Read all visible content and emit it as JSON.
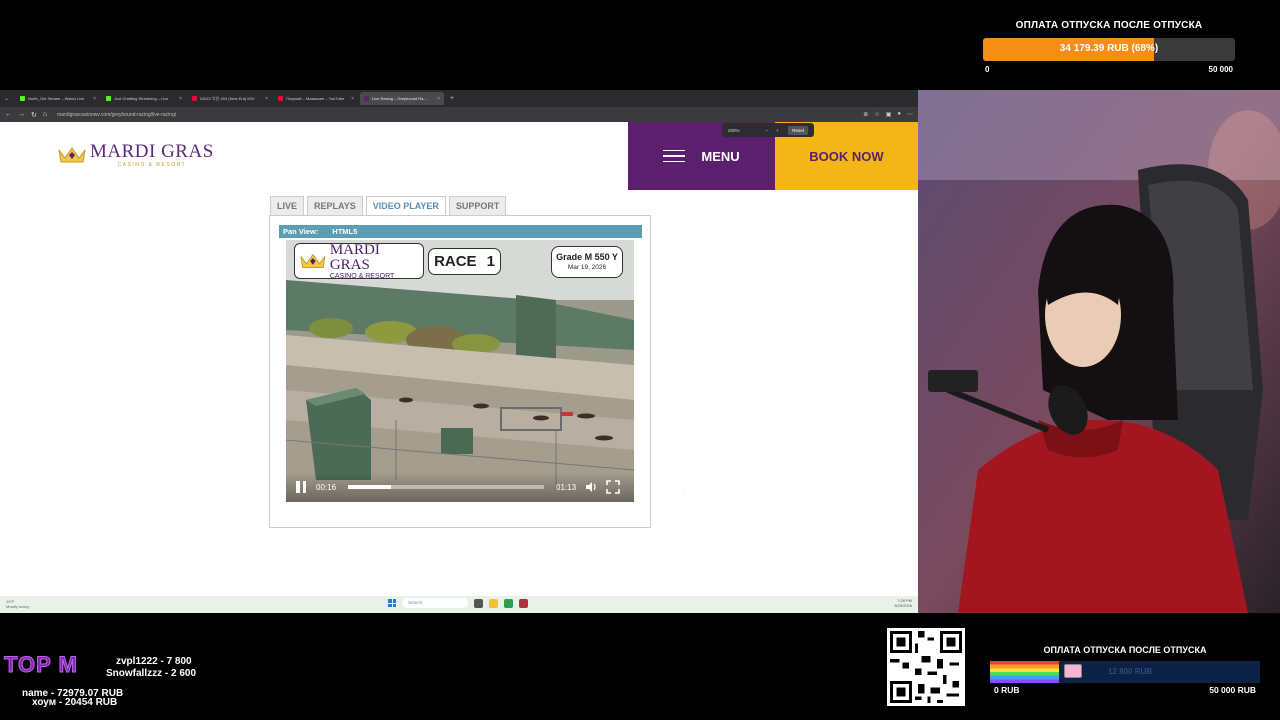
{
  "stream_goal_top": {
    "title": "ОПЛАТА ОТПУСКА ПОСЛЕ ОТПУСКА",
    "progress_text": "34 179.39 RUB (68%)",
    "progress_fraction": 0.68,
    "min_label": "0",
    "max_label": "50 000",
    "fill_color": "#f58d16"
  },
  "browser": {
    "tabs": [
      {
        "label": "North_Girl Stream – Watch Live",
        "fav_color": "#53fc18"
      },
      {
        "label": "Just Chatting Streaming – Live",
        "fav_color": "#53fc18"
      },
      {
        "label": "IGIDS 악인 404 (New Era) M/V",
        "fav_color": "#ff0033"
      },
      {
        "label": "Покупай – Мамашин – YouTube",
        "fav_color": "#ff0033"
      },
      {
        "label": "Live Racing – Greyhound Ra…",
        "fav_color": "#5b1f6e"
      }
    ],
    "active_tab_index": 4,
    "url": "mardigrascasinowv.com/greyhound-racing/live-racing/",
    "zoom": {
      "value": "200%",
      "minus": "–",
      "plus": "+",
      "reset_label": "Reset"
    }
  },
  "site": {
    "logo_text": "MARDI GRAS",
    "logo_sub": "CASINO & RESORT",
    "menu_label": "MENU",
    "book_label": "BOOK NOW",
    "brand_purple": "#5b1f6e",
    "brand_gold": "#f4b617",
    "page_tabs": [
      "LIVE",
      "REPLAYS",
      "VIDEO PLAYER",
      "SUPPORT"
    ],
    "active_page_tab": 2,
    "pan_view_label": "Pan View:",
    "pan_view_value": "HTML5"
  },
  "video": {
    "overlay_logo_1": "MARDI GRAS",
    "overlay_logo_2": "CASINO & RESORT",
    "race_label": "RACE",
    "race_number": "1",
    "grade": "Grade M   550 Y",
    "date": "Mar 19, 2026",
    "current_time": "00:16",
    "duration": "01:13",
    "played_fraction": 0.22
  },
  "taskbar": {
    "weather_temp": "19°F",
    "weather_desc": "Mostly sunny",
    "search_placeholder": "Search",
    "clock_time": "7:28 PM",
    "clock_date": "3/20/2026"
  },
  "stream_overlay": {
    "top_label": "TOP M",
    "donors": [
      "zvpl1222 - 7 800",
      "Snowfallzzz - 2 600",
      "name - 72979.07 RUB",
      "хоум - 20454 RUB"
    ],
    "goal_bottom": {
      "title": "ОПЛАТА ОТПУСКА ПОСЛЕ ОТПУСКА",
      "amount_text": "12 800 RUB",
      "progress_fraction": 0.256,
      "min_label": "0 RUB",
      "max_label": "50 000 RUB"
    }
  }
}
